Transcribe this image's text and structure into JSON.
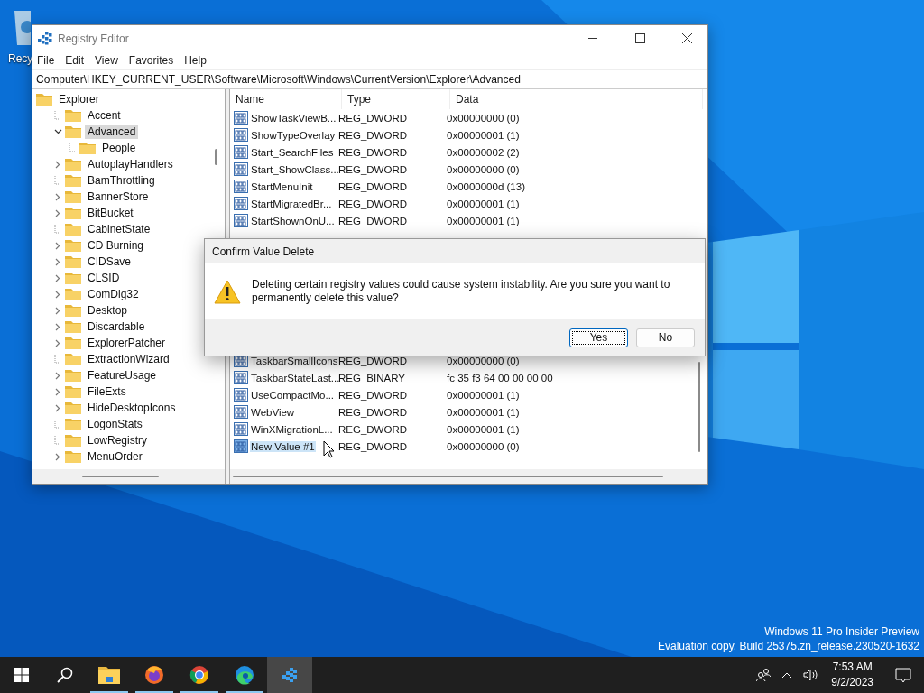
{
  "desktop": {
    "icons": [
      {
        "label": "Recy"
      }
    ],
    "watermark": [
      "Windows 11 Pro Insider Preview",
      "Evaluation copy. Build 25375.zn_release.230520-1632"
    ]
  },
  "window": {
    "title": "Registry Editor",
    "menu": [
      "File",
      "Edit",
      "View",
      "Favorites",
      "Help"
    ],
    "address": "Computer\\HKEY_CURRENT_USER\\Software\\Microsoft\\Windows\\CurrentVersion\\Explorer\\Advanced",
    "tree": [
      {
        "label": "Explorer",
        "selected": false,
        "children": [
          {
            "label": "Accent",
            "has_subkeys": false,
            "selected": false
          },
          {
            "label": "Advanced",
            "has_subkeys": true,
            "expanded": true,
            "selected": true,
            "children": [
              {
                "label": "People",
                "has_subkeys": false,
                "selected": false
              }
            ]
          },
          {
            "label": "AutoplayHandlers",
            "has_subkeys": true,
            "expanded": false,
            "selected": false
          },
          {
            "label": "BamThrottling",
            "has_subkeys": false,
            "selected": false
          },
          {
            "label": "BannerStore",
            "has_subkeys": true,
            "expanded": false,
            "selected": false
          },
          {
            "label": "BitBucket",
            "has_subkeys": true,
            "expanded": false,
            "selected": false
          },
          {
            "label": "CabinetState",
            "has_subkeys": false,
            "selected": false
          },
          {
            "label": "CD Burning",
            "has_subkeys": true,
            "expanded": false,
            "selected": false
          },
          {
            "label": "CIDSave",
            "has_subkeys": true,
            "expanded": false,
            "selected": false
          },
          {
            "label": "CLSID",
            "has_subkeys": true,
            "expanded": false,
            "selected": false
          },
          {
            "label": "ComDlg32",
            "has_subkeys": true,
            "expanded": false,
            "selected": false
          },
          {
            "label": "Desktop",
            "has_subkeys": true,
            "expanded": false,
            "selected": false
          },
          {
            "label": "Discardable",
            "has_subkeys": true,
            "expanded": false,
            "selected": false
          },
          {
            "label": "ExplorerPatcher",
            "has_subkeys": true,
            "expanded": false,
            "selected": false
          },
          {
            "label": "ExtractionWizard",
            "has_subkeys": false,
            "selected": false
          },
          {
            "label": "FeatureUsage",
            "has_subkeys": true,
            "expanded": false,
            "selected": false
          },
          {
            "label": "FileExts",
            "has_subkeys": true,
            "expanded": false,
            "selected": false
          },
          {
            "label": "HideDesktopIcons",
            "has_subkeys": true,
            "expanded": false,
            "selected": false
          },
          {
            "label": "LogonStats",
            "has_subkeys": false,
            "selected": false
          },
          {
            "label": "LowRegistry",
            "has_subkeys": false,
            "selected": false
          },
          {
            "label": "MenuOrder",
            "has_subkeys": true,
            "expanded": false,
            "selected": false
          }
        ]
      }
    ],
    "columns": [
      "Name",
      "Type",
      "Data"
    ],
    "rows": [
      {
        "name": "ShowTaskViewB...",
        "type": "REG_DWORD",
        "data": "0x00000000 (0)",
        "selected": false
      },
      {
        "name": "ShowTypeOverlay",
        "type": "REG_DWORD",
        "data": "0x00000001 (1)",
        "selected": false
      },
      {
        "name": "Start_SearchFiles",
        "type": "REG_DWORD",
        "data": "0x00000002 (2)",
        "selected": false
      },
      {
        "name": "Start_ShowClass...",
        "type": "REG_DWORD",
        "data": "0x00000000 (0)",
        "selected": false
      },
      {
        "name": "StartMenuInit",
        "type": "REG_DWORD",
        "data": "0x0000000d (13)",
        "selected": false
      },
      {
        "name": "StartMigratedBr...",
        "type": "REG_DWORD",
        "data": "0x00000001 (1)",
        "selected": false
      },
      {
        "name": "StartShownOnU...",
        "type": "REG_DWORD",
        "data": "0x00000001 (1)",
        "selected": false
      }
    ],
    "rows_below_dialog": [
      {
        "name": "TaskbarSmallIcons",
        "type": "REG_DWORD",
        "data": "0x00000000 (0)",
        "selected": false
      },
      {
        "name": "TaskbarStateLast...",
        "type": "REG_BINARY",
        "data": "fc 35 f3 64 00 00 00 00",
        "selected": false
      },
      {
        "name": "UseCompactMo...",
        "type": "REG_DWORD",
        "data": "0x00000001 (1)",
        "selected": false
      },
      {
        "name": "WebView",
        "type": "REG_DWORD",
        "data": "0x00000001 (1)",
        "selected": false
      },
      {
        "name": "WinXMigrationL...",
        "type": "REG_DWORD",
        "data": "0x00000001 (1)",
        "selected": false
      },
      {
        "name": "New Value #1",
        "type": "REG_DWORD",
        "data": "0x00000000 (0)",
        "selected": true
      }
    ]
  },
  "dialog": {
    "title": "Confirm Value Delete",
    "message": "Deleting certain registry values could cause system instability. Are you sure you want to permanently delete this value?",
    "buttons": [
      {
        "label": "Yes",
        "default": true
      },
      {
        "label": "No",
        "default": false
      }
    ]
  },
  "taskbar": {
    "items": [
      {
        "kind": "start",
        "active": false,
        "running": false
      },
      {
        "kind": "search",
        "active": false,
        "running": false
      },
      {
        "kind": "explorer",
        "active": false,
        "running": true
      },
      {
        "kind": "firefox",
        "active": false,
        "running": true
      },
      {
        "kind": "chrome",
        "active": false,
        "running": true
      },
      {
        "kind": "edge",
        "active": false,
        "running": true
      },
      {
        "kind": "regedit",
        "active": true,
        "running": true
      }
    ],
    "time": "7:53 AM",
    "date": "9/2/2023"
  }
}
